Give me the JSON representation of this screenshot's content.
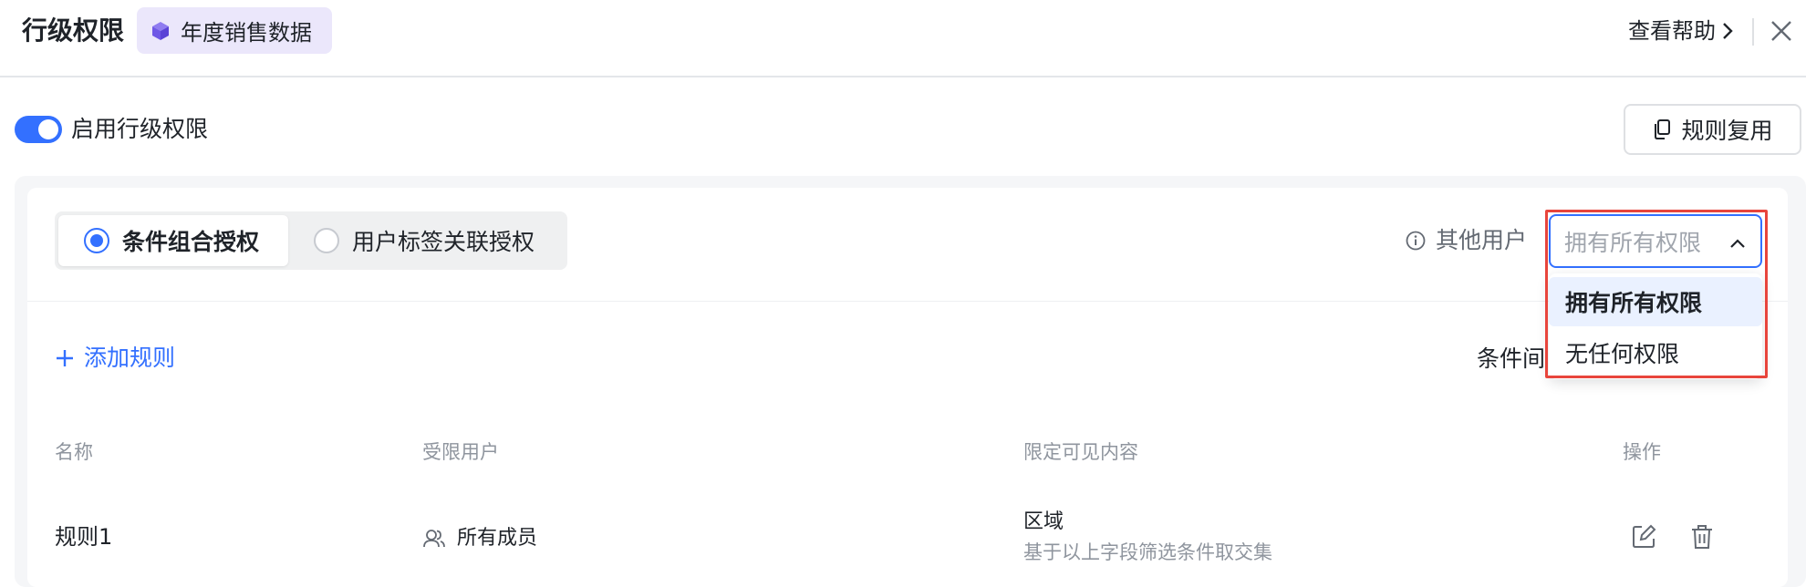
{
  "header": {
    "title": "行级权限",
    "dataset_tag": "年度销售数据",
    "help_link": "查看帮助"
  },
  "toggle": {
    "label": "启用行级权限",
    "enabled": true
  },
  "reuse_button": {
    "label": "规则复用"
  },
  "auth_mode": {
    "options": [
      {
        "label": "条件组合授权",
        "selected": true
      },
      {
        "label": "用户标签关联授权",
        "selected": false
      }
    ]
  },
  "other_users": {
    "label": "其他用户",
    "select_placeholder": "拥有所有权限",
    "options": [
      {
        "label": "拥有所有权限",
        "selected": true
      },
      {
        "label": "无任何权限",
        "selected": false
      }
    ]
  },
  "add_rule_label": "添加规则",
  "condition_label": "条件间",
  "table": {
    "columns": [
      "名称",
      "受限用户",
      "限定可见内容",
      "操作"
    ],
    "rows": [
      {
        "name": "规则1",
        "users": "所有成员",
        "content_title": "区域",
        "content_desc": "基于以上字段筛选条件取交集"
      }
    ]
  },
  "colors": {
    "accent": "#3370ff",
    "tag_bg": "#ebe7fb",
    "highlight": "#e8453c"
  }
}
